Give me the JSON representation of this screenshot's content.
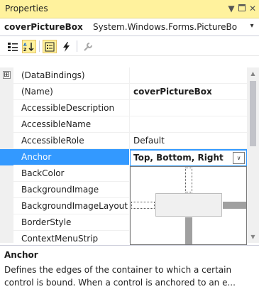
{
  "panel": {
    "title": "Properties",
    "pin_glyph": "▼",
    "close_glyph": "✕"
  },
  "object_selector": {
    "name": "coverPictureBox",
    "type": "System.Windows.Forms.PictureBo",
    "dropdown_glyph": "▾"
  },
  "toolbar": {
    "buttons": [
      {
        "icon": "categorized-icon",
        "active": false
      },
      {
        "icon": "alphabetical-icon",
        "active": true
      },
      {
        "icon": "properties-icon",
        "active": true
      },
      {
        "icon": "events-lightning-icon",
        "active": false
      },
      {
        "icon": "property-pages-wrench-icon",
        "active": false
      }
    ]
  },
  "grid": {
    "rows": [
      {
        "name": "(DataBindings)",
        "value": "",
        "expander": "⊞",
        "bold_value": false
      },
      {
        "name": "(Name)",
        "value": "coverPictureBox",
        "bold_value": true
      },
      {
        "name": "AccessibleDescription",
        "value": "",
        "bold_value": false
      },
      {
        "name": "AccessibleName",
        "value": "",
        "bold_value": false
      },
      {
        "name": "AccessibleRole",
        "value": "Default",
        "bold_value": false
      },
      {
        "name": "Anchor",
        "value": "Top, Bottom, Right",
        "bold_value": true,
        "selected": true
      },
      {
        "name": "BackColor",
        "value": "",
        "bold_value": false
      },
      {
        "name": "BackgroundImage",
        "value": "",
        "bold_value": false
      },
      {
        "name": "BackgroundImageLayout",
        "value": "",
        "bold_value": false
      },
      {
        "name": "BorderStyle",
        "value": "",
        "bold_value": false
      },
      {
        "name": "ContextMenuStrip",
        "value": "",
        "bold_value": false
      }
    ]
  },
  "anchor_editor": {
    "value": "Top, Bottom, Right",
    "dropdown_glyph": "∨",
    "anchors": {
      "top": true,
      "bottom": true,
      "left": false,
      "right": true
    }
  },
  "scrollbar": {
    "up_glyph": "▲",
    "down_glyph": "▼"
  },
  "description": {
    "title": "Anchor",
    "text": "Defines the edges of the container to which a certain control is bound. When a control is anchored to an e..."
  },
  "colors": {
    "title_bg": "#fff29d",
    "selection": "#3399ff",
    "anchored": "#a0a0a0"
  }
}
